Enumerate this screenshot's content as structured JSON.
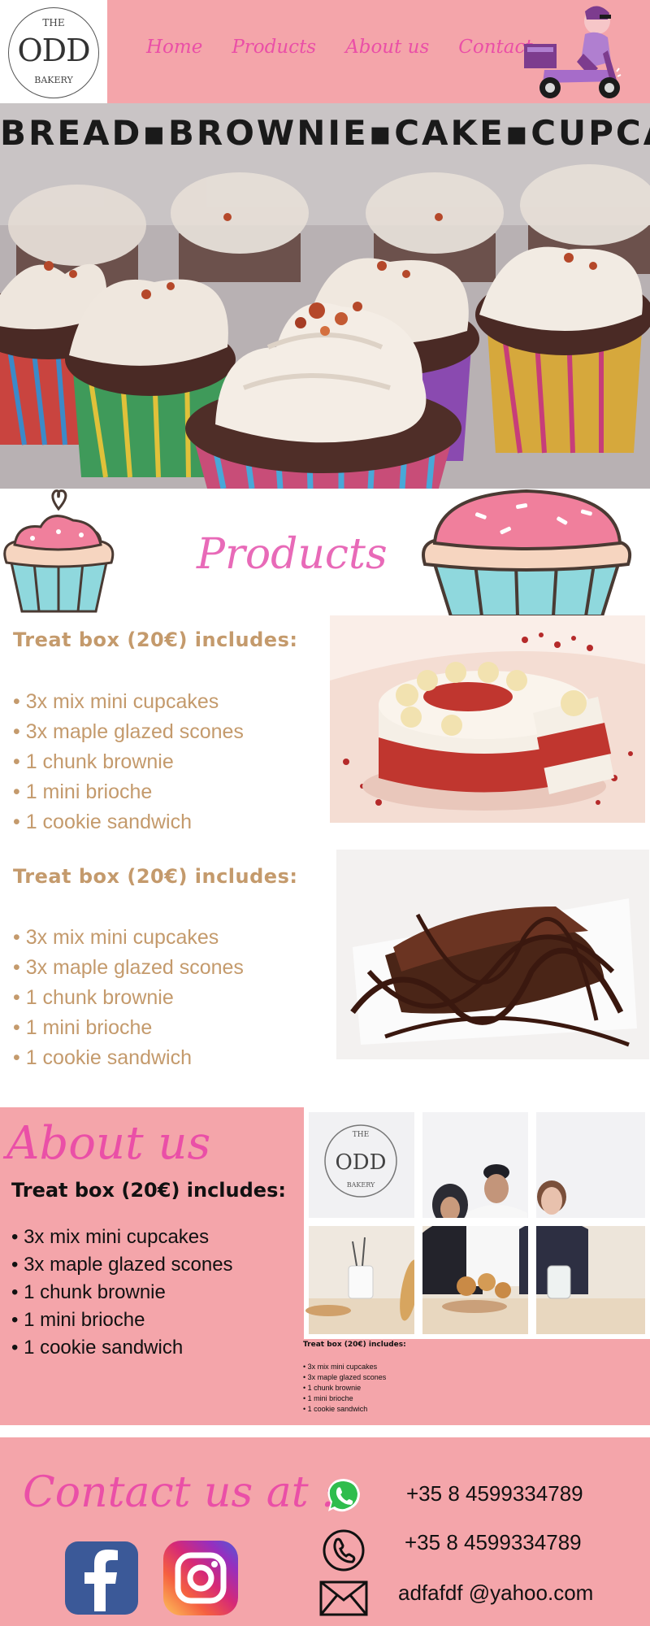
{
  "logo": {
    "the": "THE",
    "odd": "ODD",
    "bakery": "BAKERY"
  },
  "nav": [
    "Home",
    "Products",
    "About us",
    "Contact"
  ],
  "hero": {
    "title": "BREAD▪BROWNIE▪CAKE▪CUPCAKE"
  },
  "products": {
    "title": "Products",
    "boxes": [
      {
        "heading": "Treat box (20€) includes:",
        "items": [
          "• 3x mix mini cupcakes",
          "• 3x maple glazed scones",
          "• 1 chunk brownie",
          "• 1 mini brioche",
          "• 1 cookie sandwich"
        ]
      },
      {
        "heading": "Treat box (20€) includes:",
        "items": [
          "• 3x mix mini cupcakes",
          "• 3x maple glazed scones",
          "• 1 chunk brownie",
          "• 1 mini brioche",
          "• 1 cookie sandwich"
        ]
      }
    ]
  },
  "about": {
    "title": "About us",
    "heading": "Treat box (20€) includes:",
    "items": [
      "• 3x mix mini cupcakes",
      "• 3x maple glazed scones",
      "• 1 chunk brownie",
      "• 1 mini brioche",
      "• 1 cookie sandwich"
    ],
    "small_heading": "Treat box (20€) includes:",
    "small_items": [
      "• 3x mix mini cupcakes",
      "• 3x maple glazed scones",
      "• 1 chunk brownie",
      "• 1 mini brioche",
      "• 1 cookie sandwich"
    ]
  },
  "contact": {
    "title": "Contact us at :",
    "whatsapp": "+35 8 4599334789",
    "phone": "+35 8 4599334789",
    "email": "adfafdf @yahoo.com"
  },
  "colors": {
    "pink_band": "#f4a5aa",
    "nav_pink": "#ea4fa7",
    "tan_text": "#c49a6c"
  },
  "icons": [
    "scooter-icon",
    "cupcake-icon",
    "whatsapp-icon",
    "phone-icon",
    "mail-icon",
    "facebook-icon",
    "instagram-icon"
  ]
}
